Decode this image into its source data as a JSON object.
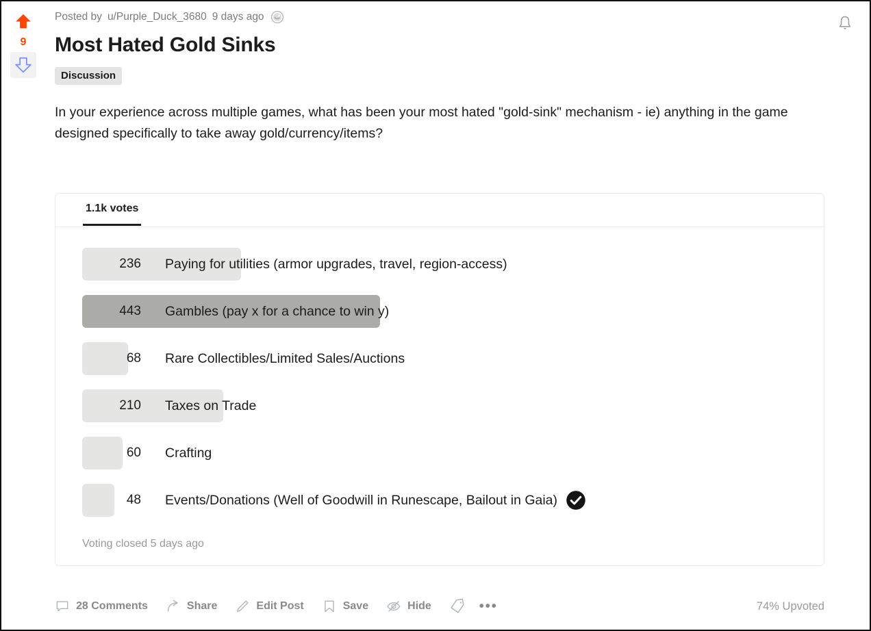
{
  "post": {
    "byline_prefix": "Posted by",
    "author": "u/Purple_Duck_3680",
    "timestamp": "9 days ago",
    "award_icon": "award-badge-icon",
    "title": "Most Hated Gold Sinks",
    "flair": "Discussion",
    "body": "In your experience across multiple games, what has been your most hated \"gold-sink\" mechanism - ie) anything in the game designed specifically to take away gold/currency/items?"
  },
  "votes": {
    "score": "9",
    "upvote_icon": "upvote-arrow-icon",
    "downvote_icon": "downvote-arrow-icon",
    "upvote_color": "#ff4500",
    "downvote_color": "#7193ff"
  },
  "notifications": {
    "icon": "bell-icon"
  },
  "poll": {
    "tab_label": "1.1k votes",
    "total_votes": 1065,
    "max_votes": 443,
    "voted_icon": "check-circle-icon",
    "closed_text": "Voting closed 5 days ago",
    "options": [
      {
        "count": "236",
        "label": "Paying for utilities (armor upgrades, travel, region-access)",
        "value": 236,
        "winner": false,
        "voted": false
      },
      {
        "count": "443",
        "label": "Gambles (pay x for a chance to win y)",
        "value": 443,
        "winner": true,
        "voted": false
      },
      {
        "count": "68",
        "label": "Rare Collectibles/Limited Sales/Auctions",
        "value": 68,
        "winner": false,
        "voted": false
      },
      {
        "count": "210",
        "label": "Taxes on Trade",
        "value": 210,
        "winner": false,
        "voted": false
      },
      {
        "count": "60",
        "label": "Crafting",
        "value": 60,
        "winner": false,
        "voted": false
      },
      {
        "count": "48",
        "label": "Events/Donations (Well of Goodwill in Runescape, Bailout in Gaia)",
        "value": 48,
        "winner": false,
        "voted": true
      }
    ]
  },
  "footer": {
    "comments_label": "28 Comments",
    "share_label": "Share",
    "edit_label": "Edit Post",
    "save_label": "Save",
    "hide_label": "Hide",
    "upvoted_label": "74% Upvoted",
    "comments_icon": "comment-bubble-icon",
    "share_icon": "share-arrow-icon",
    "edit_icon": "pencil-icon",
    "save_icon": "bookmark-icon",
    "hide_icon": "eye-off-icon",
    "tag_icon": "tag-icon",
    "more_icon": "more-dots-icon"
  },
  "chart_data": {
    "type": "bar",
    "title": "Most Hated Gold Sinks",
    "categories": [
      "Paying for utilities (armor upgrades, travel, region-access)",
      "Gambles (pay x for a chance to win y)",
      "Rare Collectibles/Limited Sales/Auctions",
      "Taxes on Trade",
      "Crafting",
      "Events/Donations (Well of Goodwill in Runescape, Bailout in Gaia)"
    ],
    "values": [
      236,
      443,
      68,
      210,
      60,
      48
    ],
    "xlabel": "Votes",
    "ylabel": "",
    "xlim": [
      0,
      443
    ],
    "grid": false,
    "legend": "none"
  }
}
